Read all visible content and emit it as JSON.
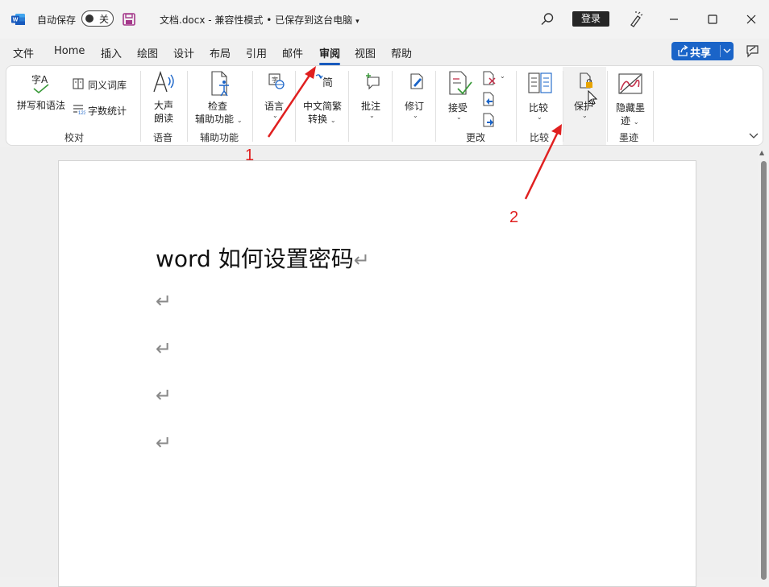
{
  "titlebar": {
    "autosave_label": "自动保存",
    "autosave_state": "关",
    "doc_title": "文档.docx  -  兼容性模式 • 已保存到这台电脑",
    "login": "登录"
  },
  "tabs": [
    {
      "label": "文件"
    },
    {
      "label": "Home"
    },
    {
      "label": "插入"
    },
    {
      "label": "绘图"
    },
    {
      "label": "设计"
    },
    {
      "label": "布局"
    },
    {
      "label": "引用"
    },
    {
      "label": "邮件"
    },
    {
      "label": "审阅",
      "active": true
    },
    {
      "label": "视图"
    },
    {
      "label": "帮助"
    }
  ],
  "share": {
    "label": "共享"
  },
  "ribbon": {
    "proofing": {
      "spell_label": "拼写和语法",
      "spell_icon_text": "字A",
      "thesaurus_label": "同义词库",
      "wordcount_label": "字数统计",
      "group_label": "校对"
    },
    "speech": {
      "read_aloud_line1": "大声",
      "read_aloud_line2": "朗读",
      "group_label": "语音"
    },
    "accessibility": {
      "check_line1": "检查",
      "check_line2": "辅助功能",
      "group_label": "辅助功能"
    },
    "language": {
      "label": "语言"
    },
    "chinese": {
      "icon_text": "简",
      "line1": "中文简繁",
      "line2": "转换"
    },
    "comments": {
      "label": "批注"
    },
    "tracking": {
      "label": "修订"
    },
    "changes": {
      "accept_label": "接受",
      "group_label": "更改"
    },
    "compare": {
      "label": "比较",
      "group_label": "比较"
    },
    "protect": {
      "label": "保护"
    },
    "ink": {
      "line1": "隐藏墨",
      "line2": "迹",
      "group_label": "墨迹"
    }
  },
  "document": {
    "heading": "word 如何设置密码",
    "pilcrow": "↵"
  },
  "annotations": {
    "one": "1",
    "two": "2",
    "color": "#e02020"
  },
  "colors": {
    "accent": "#185abd",
    "share_bg": "#1a64c8"
  }
}
